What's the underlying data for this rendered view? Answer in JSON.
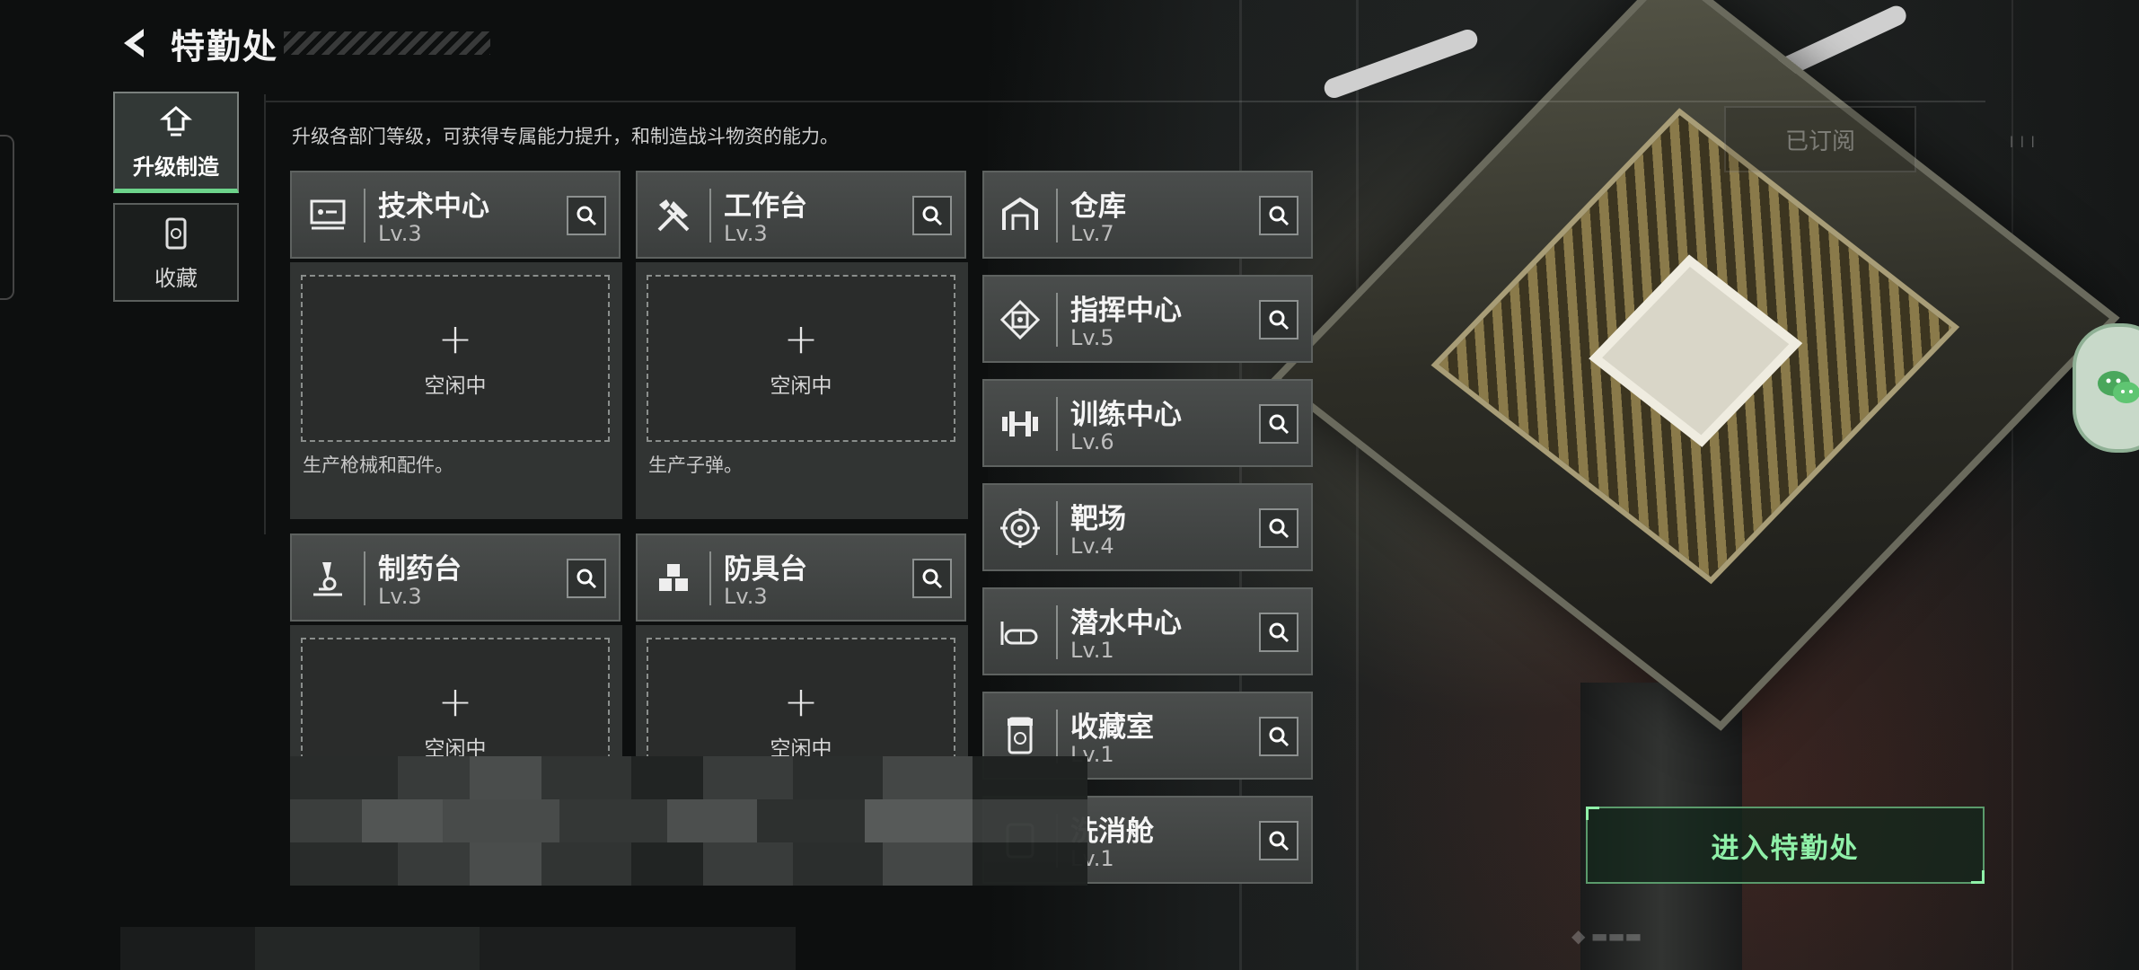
{
  "header": {
    "title": "特勤处"
  },
  "sidebar": {
    "tabs": [
      {
        "label": "升级制造",
        "active": true
      },
      {
        "label": "收藏",
        "active": false
      }
    ]
  },
  "subtitle": "升级各部门等级，可获得专属能力提升，和制造战斗物资的能力。",
  "subscribed_label": "已订阅",
  "workbenches": [
    {
      "name": "技术中心",
      "level": "Lv.3",
      "icon": "tech-center-icon",
      "slot_state": "空闲中",
      "description": "生产枪械和配件。"
    },
    {
      "name": "工作台",
      "level": "Lv.3",
      "icon": "workbench-tools-icon",
      "slot_state": "空闲中",
      "description": "生产子弹。"
    },
    {
      "name": "制药台",
      "level": "Lv.3",
      "icon": "microscope-icon",
      "slot_state": "空闲中",
      "description": ""
    },
    {
      "name": "防具台",
      "level": "Lv.3",
      "icon": "armor-blocks-icon",
      "slot_state": "空闲中",
      "description": ""
    }
  ],
  "facilities": [
    {
      "name": "仓库",
      "level": "Lv.7",
      "icon": "warehouse-icon"
    },
    {
      "name": "指挥中心",
      "level": "Lv.5",
      "icon": "command-chip-icon"
    },
    {
      "name": "训练中心",
      "level": "Lv.6",
      "icon": "dumbbell-icon"
    },
    {
      "name": "靶场",
      "level": "Lv.4",
      "icon": "target-icon"
    },
    {
      "name": "潜水中心",
      "level": "Lv.1",
      "icon": "diving-mask-icon"
    },
    {
      "name": "收藏室",
      "level": "Lv.1",
      "icon": "collection-pod-icon"
    },
    {
      "name": "洗消舱",
      "level": "Lv.1",
      "icon": "decon-icon"
    }
  ],
  "enter_button": "进入特勤处",
  "colors": {
    "accent": "#6cd38a",
    "panel": "#3b3e3d",
    "enter_text": "#8ff0a8"
  }
}
